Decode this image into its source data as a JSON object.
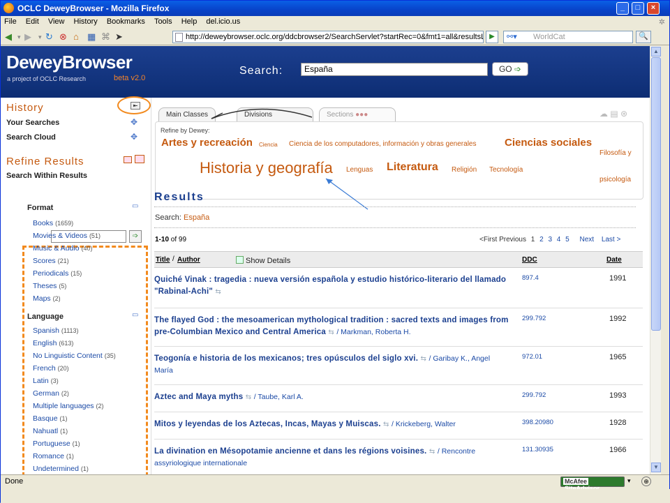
{
  "window": {
    "title": "OCLC DeweyBrowser - Mozilla Firefox"
  },
  "menu": [
    "File",
    "Edit",
    "View",
    "History",
    "Bookmarks",
    "Tools",
    "Help",
    "del.icio.us"
  ],
  "nav": {
    "url": "http://deweybrowser.oclc.org/ddcbrowser2/SearchServlet?startRec=0&fmt1=all&resultsLang=",
    "search_engine": "WorldCat"
  },
  "banner": {
    "logo": "DeweyBrowser",
    "subtitle": "a project of OCLC Research",
    "beta": "beta v2.0",
    "search_label": "Search:",
    "search_value": "España",
    "go_label": "GO"
  },
  "sidebar": {
    "history_heading": "History",
    "your_searches": "Your Searches",
    "search_cloud": "Search Cloud",
    "refine_heading": "Refine Results",
    "search_within": "Search Within Results",
    "format_heading": "Format",
    "formats": [
      {
        "label": "Books",
        "count": "(1659)"
      },
      {
        "label": "Movies & Videos",
        "count": "(51)"
      },
      {
        "label": "Music & Audio",
        "count": "(40)"
      },
      {
        "label": "Scores",
        "count": "(21)"
      },
      {
        "label": "Periodicals",
        "count": "(15)"
      },
      {
        "label": "Theses",
        "count": "(5)"
      },
      {
        "label": "Maps",
        "count": "(2)"
      }
    ],
    "language_heading": "Language",
    "languages": [
      {
        "label": "Spanish",
        "count": "(1113)"
      },
      {
        "label": "English",
        "count": "(613)"
      },
      {
        "label": "No Linguistic Content",
        "count": "(35)"
      },
      {
        "label": "French",
        "count": "(20)"
      },
      {
        "label": "Latin",
        "count": "(3)"
      },
      {
        "label": "German",
        "count": "(2)"
      },
      {
        "label": "Multiple languages",
        "count": "(2)"
      },
      {
        "label": "Basque",
        "count": "(1)"
      },
      {
        "label": "Nahuatl",
        "count": "(1)"
      },
      {
        "label": "Portuguese",
        "count": "(1)"
      },
      {
        "label": "Romance",
        "count": "(1)"
      },
      {
        "label": "Undetermined",
        "count": "(1)"
      }
    ]
  },
  "tabs": [
    "Main Classes",
    "Divisions",
    "Sections"
  ],
  "refine": {
    "label": "Refine by Dewey:",
    "cloud": [
      {
        "label": "Artes y recreación",
        "weight": "large"
      },
      {
        "label": "Ciencia",
        "weight": "tiny"
      },
      {
        "label": "Ciencia de los computadores, información y obras generales",
        "weight": "small"
      },
      {
        "label": "Ciencias sociales",
        "weight": "large"
      },
      {
        "label": "Filosofía y psicología",
        "weight": "small"
      },
      {
        "label": "Historia y geografía",
        "weight": "xlarge"
      },
      {
        "label": "Lenguas",
        "weight": "small"
      },
      {
        "label": "Literatura",
        "weight": "large"
      },
      {
        "label": "Religión",
        "weight": "small"
      },
      {
        "label": "Tecnología",
        "weight": "small"
      }
    ]
  },
  "results": {
    "heading": "Results",
    "search_prefix": "Search:",
    "search_value": "España",
    "range": "1-10",
    "of": "of 99",
    "pager": {
      "first": "<First",
      "previous": "Previous",
      "pages": [
        "1",
        "2",
        "3",
        "4",
        "5"
      ],
      "next": "Next",
      "last": "Last >"
    },
    "columns": {
      "title": "Title",
      "author": "Author",
      "show_details": "Show Details",
      "ddc": "DDC",
      "date": "Date"
    },
    "rows": [
      {
        "title": "Quiché Vinak : tragedia : nueva versión española y estudio histórico-literario del llamado \"Rabinal-Achi\"",
        "author": "",
        "ddc": "897.4",
        "date": "1991"
      },
      {
        "title": "The flayed God : the mesoamerican mythological tradition : sacred texts and images from pre-Columbian Mexico and Central America",
        "author": "/ Markman, Roberta H.",
        "ddc": "299.792",
        "date": "1992"
      },
      {
        "title": "Teogonía e historia de los mexicanos; tres opúsculos del siglo xvi.",
        "author": "/ Garibay K., Angel María",
        "ddc": "972.01",
        "date": "1965"
      },
      {
        "title": "Aztec and Maya myths",
        "author": "/ Taube, Karl A.",
        "ddc": "299.792",
        "date": "1993"
      },
      {
        "title": "Mitos y leyendas de los Aztecas, Incas, Mayas y Muiscas.",
        "author": "/ Krickeberg, Walter",
        "ddc": "398.20980",
        "date": "1928"
      },
      {
        "title": "La divination en Mésopotamie ancienne et dans les régions voisines.",
        "author": "/ Rencontre assyriologique internationale",
        "ddc": "131.30935",
        "date": "1966"
      }
    ]
  },
  "status": {
    "text": "Done",
    "mcafee": "McAfee",
    "siteadvisor": "SiteAdvisor"
  }
}
